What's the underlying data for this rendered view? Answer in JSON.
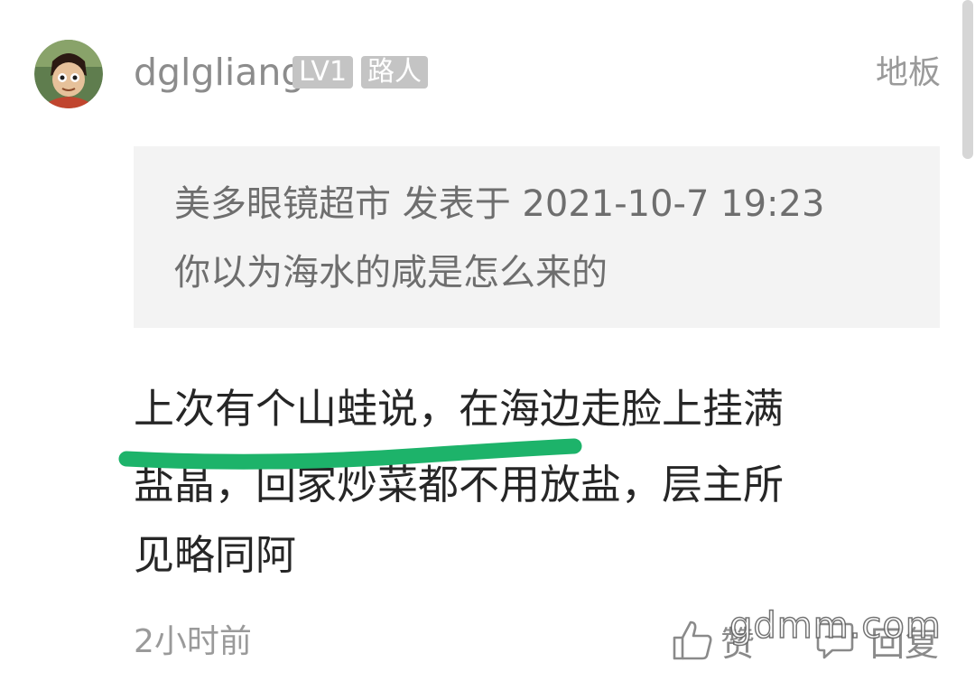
{
  "post": {
    "username": "dglgliang",
    "level_badge": "LV1",
    "role_badge": "路人",
    "floor": "地板"
  },
  "quote": {
    "header": "美多眼镜超市 发表于 2021-10-7 19:23",
    "text": "你以为海水的咸是怎么来的"
  },
  "reply": {
    "lines": [
      "上次有个山蛙说，在海边走脸上挂满",
      "盐晶，回家炒菜都不用放盐，层主所",
      "见略同阿"
    ]
  },
  "footer": {
    "time": "2小时前",
    "like_label": "赞",
    "reply_label": "回复"
  },
  "watermark": "gdmm.com",
  "colors": {
    "highlight_marker": "#1db36a",
    "badge_bg": "#c4c4c4",
    "quote_bg": "#f3f3f3"
  }
}
